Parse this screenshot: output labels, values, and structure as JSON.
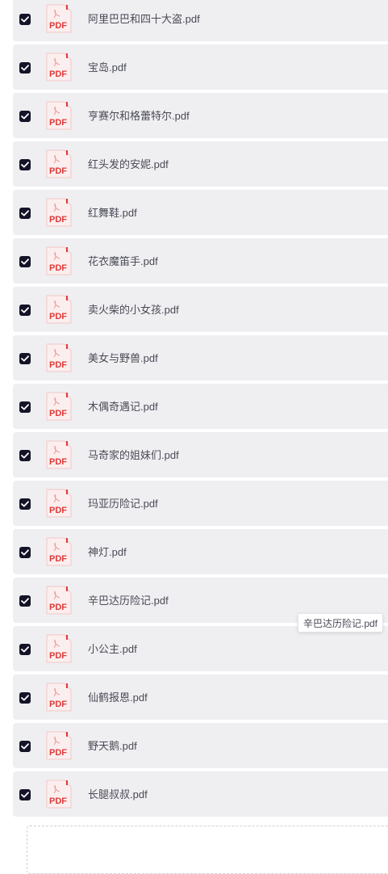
{
  "file_list": {
    "items": [
      {
        "name": "阿里巴巴和四十大盗.pdf",
        "checked": true,
        "icon": "pdf-file-icon",
        "icon_label": "PDF"
      },
      {
        "name": "宝岛.pdf",
        "checked": true,
        "icon": "pdf-file-icon",
        "icon_label": "PDF"
      },
      {
        "name": "亨赛尔和格蕾特尔.pdf",
        "checked": true,
        "icon": "pdf-file-icon",
        "icon_label": "PDF"
      },
      {
        "name": "红头发的安妮.pdf",
        "checked": true,
        "icon": "pdf-file-icon",
        "icon_label": "PDF"
      },
      {
        "name": "红舞鞋.pdf",
        "checked": true,
        "icon": "pdf-file-icon",
        "icon_label": "PDF"
      },
      {
        "name": "花衣魔笛手.pdf",
        "checked": true,
        "icon": "pdf-file-icon",
        "icon_label": "PDF"
      },
      {
        "name": "卖火柴的小女孩.pdf",
        "checked": true,
        "icon": "pdf-file-icon",
        "icon_label": "PDF"
      },
      {
        "name": "美女与野兽.pdf",
        "checked": true,
        "icon": "pdf-file-icon",
        "icon_label": "PDF"
      },
      {
        "name": "木偶奇遇记.pdf",
        "checked": true,
        "icon": "pdf-file-icon",
        "icon_label": "PDF"
      },
      {
        "name": "马奇家的姐妹们.pdf",
        "checked": true,
        "icon": "pdf-file-icon",
        "icon_label": "PDF"
      },
      {
        "name": "玛亚历险记.pdf",
        "checked": true,
        "icon": "pdf-file-icon",
        "icon_label": "PDF"
      },
      {
        "name": "神灯.pdf",
        "checked": true,
        "icon": "pdf-file-icon",
        "icon_label": "PDF"
      },
      {
        "name": "辛巴达历险记.pdf",
        "checked": true,
        "icon": "pdf-file-icon",
        "icon_label": "PDF"
      },
      {
        "name": "小公主.pdf",
        "checked": true,
        "icon": "pdf-file-icon",
        "icon_label": "PDF"
      },
      {
        "name": "仙鹤报恩.pdf",
        "checked": true,
        "icon": "pdf-file-icon",
        "icon_label": "PDF"
      },
      {
        "name": "野天鹅.pdf",
        "checked": true,
        "icon": "pdf-file-icon",
        "icon_label": "PDF"
      },
      {
        "name": "长腿叔叔.pdf",
        "checked": true,
        "icon": "pdf-file-icon",
        "icon_label": "PDF"
      }
    ]
  },
  "tooltip": {
    "text": "辛巴达历险记.pdf"
  },
  "colors": {
    "row_background": "#efeff2",
    "checkbox_fill": "#141428",
    "pdf_red": "#e03a3a",
    "text": "#4a4a55"
  }
}
